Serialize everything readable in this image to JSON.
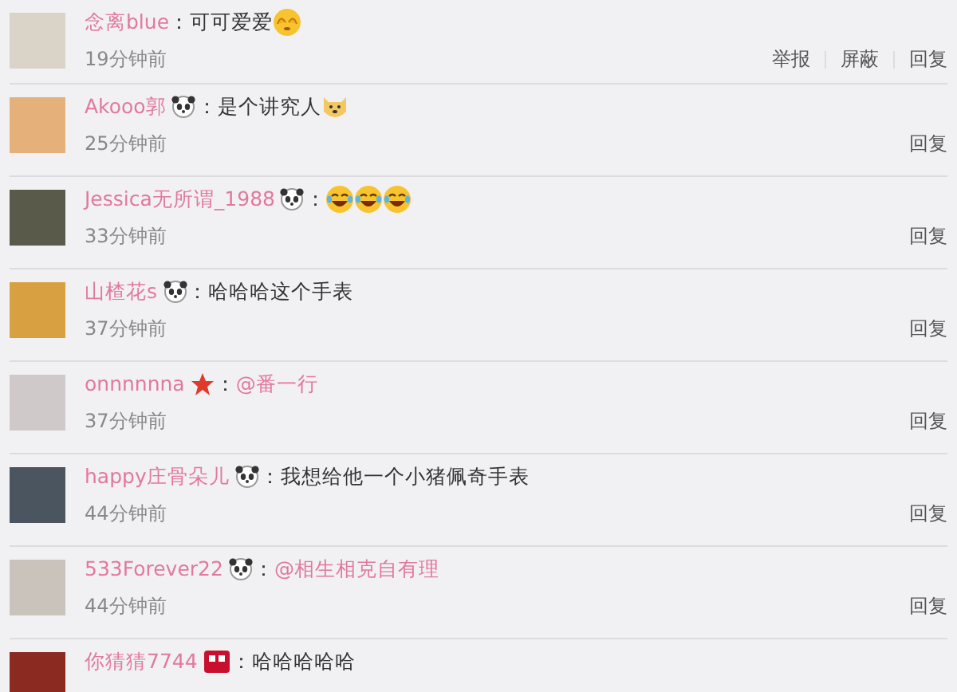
{
  "comments": [
    {
      "name": "念离blue",
      "colon": "：",
      "comment": {
        "kind": "text",
        "text": "可可爱爱"
      },
      "emojis": [
        {
          "kind": "shy"
        }
      ],
      "time": "19分钟前",
      "actions": [
        "举报",
        "屏蔽",
        "回复"
      ]
    },
    {
      "name": "Akooo郭",
      "badges": [
        {
          "kind": "panda"
        }
      ],
      "colon": "：",
      "comment": {
        "kind": "text",
        "text": "是个讲究人"
      },
      "emojis": [
        {
          "kind": "dog"
        }
      ],
      "time": "25分钟前",
      "actions": [
        "回复"
      ]
    },
    {
      "name": "Jessica无所谓_1988",
      "badges": [
        {
          "kind": "panda"
        }
      ],
      "colon": "：",
      "emojis": [
        {
          "kind": "laugh"
        },
        {
          "kind": "laugh"
        },
        {
          "kind": "laugh"
        }
      ],
      "time": "33分钟前",
      "actions": [
        "回复"
      ]
    },
    {
      "name": "山楂花s",
      "badges": [
        {
          "kind": "panda"
        }
      ],
      "colon": "：",
      "comment": {
        "kind": "text",
        "text": "哈哈哈这个手表"
      },
      "time": "37分钟前",
      "actions": [
        "回复"
      ]
    },
    {
      "name": "onnnnnna",
      "badges": [
        {
          "kind": "star"
        }
      ],
      "colon": "：",
      "comment": {
        "kind": "mention",
        "text": "@番一行"
      },
      "time": "37分钟前",
      "actions": [
        "回复"
      ]
    },
    {
      "name": "happy庄骨朵儿",
      "badges": [
        {
          "kind": "panda"
        }
      ],
      "colon": "：",
      "comment": {
        "kind": "text",
        "text": "我想给他一个小猪佩奇手表"
      },
      "time": "44分钟前",
      "actions": [
        "回复"
      ]
    },
    {
      "name": "533Forever22",
      "badges": [
        {
          "kind": "panda"
        }
      ],
      "colon": "：",
      "comment": {
        "kind": "mention",
        "text": "@相生相克自有理"
      },
      "time": "44分钟前",
      "actions": [
        "回复"
      ]
    },
    {
      "name": "你猜猜7744",
      "badges": [
        {
          "kind": "red"
        }
      ],
      "colon": "：",
      "comment": {
        "kind": "text",
        "text": "哈哈哈哈哈"
      }
    }
  ]
}
